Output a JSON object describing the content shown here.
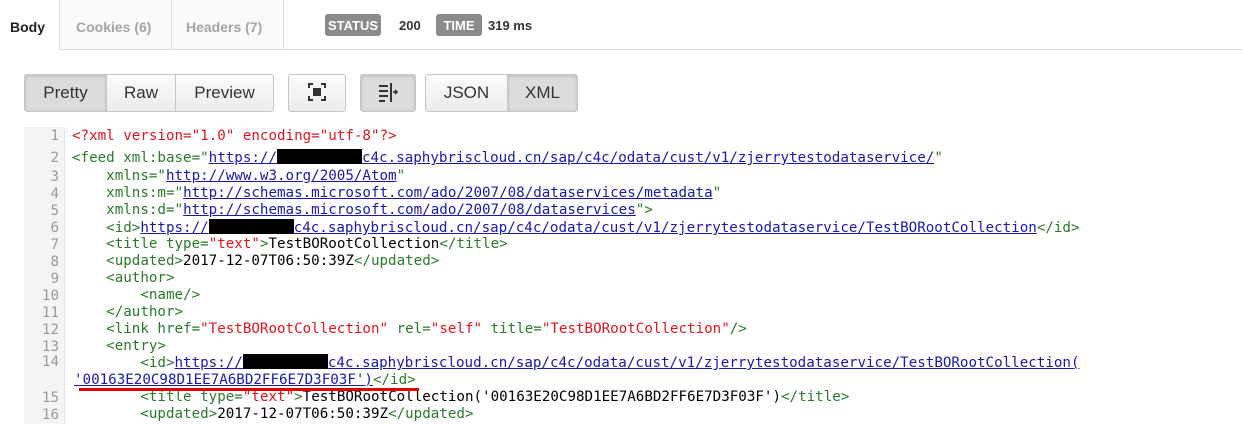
{
  "tabs": [
    {
      "label": "Body"
    },
    {
      "label": "Cookies (6)"
    },
    {
      "label": "Headers (7)"
    }
  ],
  "status": {
    "label": "STATUS",
    "value": "200"
  },
  "time": {
    "label": "TIME",
    "value": "319 ms"
  },
  "view_modes": [
    "Pretty",
    "Raw",
    "Preview"
  ],
  "formats": [
    "JSON",
    "XML"
  ],
  "selected_view_mode": "Pretty",
  "selected_format": "XML",
  "icons": {
    "fullscreen": "fullscreen-icon",
    "wrap": "word-wrap-icon"
  },
  "colors": {
    "tag": "#2b7a2b",
    "attribute_value": "#e0141e",
    "link": "#1a1aa6",
    "underline_mark": "#e10000"
  },
  "code": {
    "line_numbers": [
      "1",
      "2",
      "3",
      "4",
      "5",
      "6",
      "7",
      "8",
      "9",
      "10",
      "11",
      "12",
      "13",
      "14",
      "15",
      "16"
    ],
    "l1": {
      "text": "<?xml version=\"1.0\" encoding=\"utf-8\"?>"
    },
    "l2": {
      "tag": "<feed ",
      "attr": "xml:base=",
      "q1": "\"",
      "url_after": "c4c.saphybriscloud.cn/sap/c4c/odata/cust/v1/zjerrytestodataservice/",
      "url_before": "https://",
      "q2": "\""
    },
    "l3": {
      "attr": "xmlns=",
      "q1": "\"",
      "url": "http://www.w3.org/2005/Atom",
      "q2": "\""
    },
    "l4": {
      "attr": "xmlns:m=",
      "q1": "\"",
      "url": "http://schemas.microsoft.com/ado/2007/08/dataservices/metadata",
      "q2": "\""
    },
    "l5": {
      "attr": "xmlns:d=",
      "q1": "\"",
      "url": "http://schemas.microsoft.com/ado/2007/08/dataservices",
      "q2": "\"",
      "close": ">"
    },
    "l6": {
      "open": "<id>",
      "url_before": "https://",
      "url_after": "c4c.saphybriscloud.cn/sap/c4c/odata/cust/v1/zjerrytestodataservice/TestBORootCollection",
      "close": "</id>"
    },
    "l7": {
      "open": "<title ",
      "attr": "type=",
      "val": "\"text\"",
      "gt": ">",
      "text": "TestBORootCollection",
      "close": "</title>"
    },
    "l8": {
      "open": "<updated>",
      "text": "2017-12-07T06:50:39Z",
      "close": "</updated>"
    },
    "l9": {
      "tag": "<author>"
    },
    "l10": {
      "tag": "<name/>"
    },
    "l11": {
      "tag": "</author>"
    },
    "l12": {
      "open": "<link ",
      "a1": "href=",
      "v1": "\"TestBORootCollection\"",
      "a2": " rel=",
      "v2": "\"self\"",
      "a3": " title=",
      "v3": "\"TestBORootCollection\"",
      "close": "/>"
    },
    "l13": {
      "tag": "<entry>"
    },
    "l14": {
      "open": "<id>",
      "url_before": "https://",
      "url_after": "c4c.saphybriscloud.cn/sap/c4c/odata/cust/v1/zjerrytestodataservice/TestBORootCollection("
    },
    "l14b": {
      "url": "'00163E20C98D1EE7A6BD2FF6E7D3F03F')",
      "close": "</id>"
    },
    "l15": {
      "open": "<title ",
      "attr": "type=",
      "val": "\"text\"",
      "gt": ">",
      "text": "TestBORootCollection('00163E20C98D1EE7A6BD2FF6E7D3F03F')",
      "close": "</title>"
    },
    "l16": {
      "open": "<updated>",
      "text": "2017-12-07T06:50:39Z",
      "close": "</updated>"
    }
  }
}
